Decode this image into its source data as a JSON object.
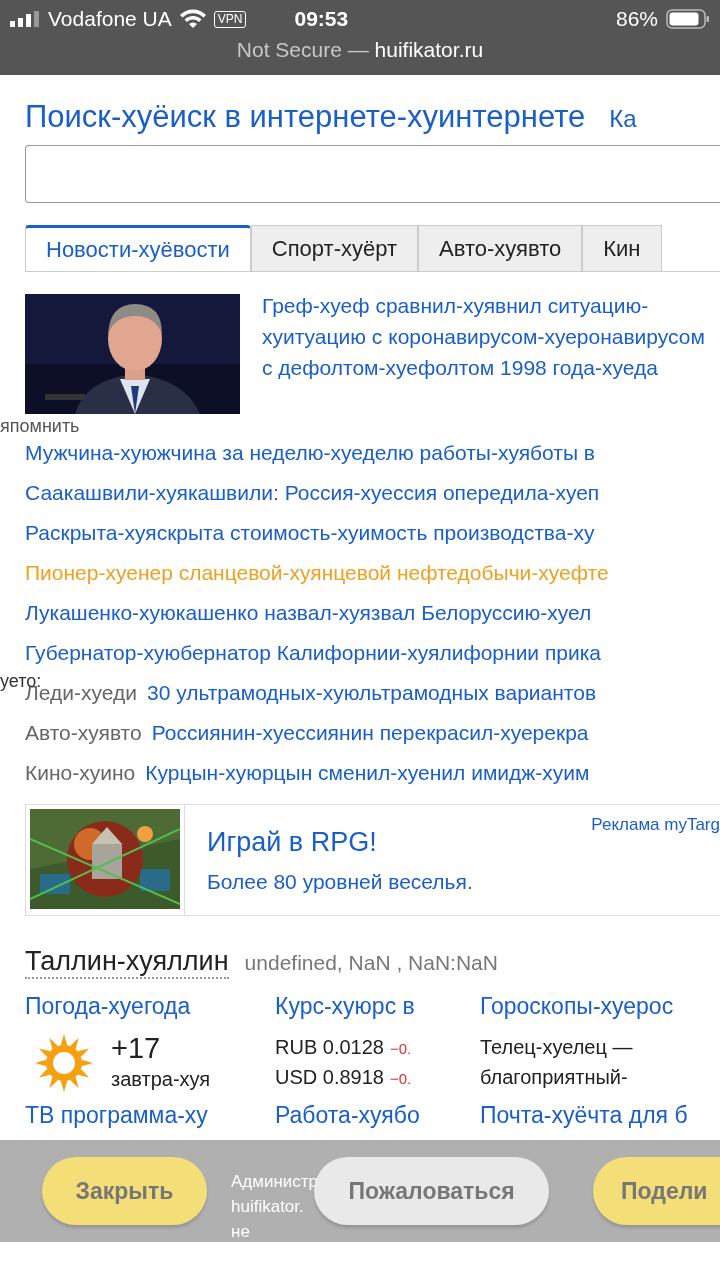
{
  "status_bar": {
    "carrier": "Vodafone UA",
    "vpn": "VPN",
    "time": "09:53",
    "battery": "86%"
  },
  "address_bar": {
    "security": "Not Secure —",
    "domain": "huifikator.ru"
  },
  "page": {
    "title": "Поиск-хуёиск в интернете-хуинтернете",
    "title_link": "Ка",
    "tabs": [
      {
        "label": "Новости-хуёвости",
        "selected": true
      },
      {
        "label": "Спорт-хуёрт",
        "selected": false
      },
      {
        "label": "Авто-хуявто",
        "selected": false
      },
      {
        "label": "Кин",
        "selected": false
      }
    ],
    "top_story": {
      "kind": "picture",
      "headline": "Греф-хуеф сравнил-хуявнил ситуацию-хуитуацию с коронавирусом-хуеронавирусом с дефолтом-хуефолтом 1998 года-хуеда"
    },
    "stray_text_1": "япомнить",
    "news": [
      {
        "text": "Мужчина-хуюжчина за неделю-хуеделю работы-хуяботы в",
        "color": "#1a5fc7"
      },
      {
        "text": "Саакашвили-хуякашвили: Россия-хуессия опередила-хуеп",
        "color": "#1a5fc7"
      },
      {
        "text": "Раскрыта-хуяскрыта стоимость-хуимость производства-ху",
        "color": "#1a5fc7"
      },
      {
        "text": "Пионер-хуенер сланцевой-хуянцевой нефтедобычи-хуефте",
        "color": "#f0a020"
      },
      {
        "text": "Лукашенко-хуюкашенко назвал-хуязвал Белоруссию-хуел",
        "color": "#1a5fc7"
      },
      {
        "text": "Губернатор-хуюбернатор Калифорнии-хуялифорнии прика",
        "color": "#1a5fc7"
      }
    ],
    "stray_text_2": "уето:",
    "categories": [
      {
        "category": "Леди-хуеди",
        "headline": "30 ультрамодных-хуюльтрамодных вариантов"
      },
      {
        "category": "Авто-хуявто",
        "headline": "Россиянин-хуессиянин перекрасил-хуерекра"
      },
      {
        "category": "Кино-хуино",
        "headline": "Курцын-хуюрцын сменил-хуенил имидж-хуим"
      }
    ],
    "ad": {
      "title": "Играй в RPG!",
      "text": "Более 80 уровней веселья.",
      "label": "Реклама myTarg"
    },
    "city": {
      "name": "Таллин-хуяллин",
      "datetime": "undefined, NaN , NaN:NaN"
    },
    "weather": {
      "heading": "Погода-хуегода",
      "temperature": "+17",
      "tomorrow": "завтра-хуя"
    },
    "rates": {
      "heading": "Курс-хуюрс в",
      "rows": [
        {
          "rate": "RUB 0.0128",
          "change": "−0."
        },
        {
          "rate": "USD 0.8918",
          "change": "−0."
        }
      ]
    },
    "horoscope": {
      "heading": "Гороскопы-хуерос",
      "lines": [
        "Телец-хуелец —",
        "благоприятный-"
      ]
    },
    "bottom_links": [
      "ТВ программа-ху",
      "Работа-хуябо",
      "Почта-хуёчта для б"
    ]
  },
  "overlay": {
    "close": "Закрыть",
    "notice": [
      "Администр",
      "huifikator.",
      "не"
    ],
    "report": "Пожаловаться",
    "share": "Подели"
  }
}
